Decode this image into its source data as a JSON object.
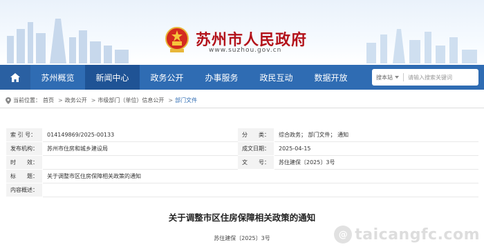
{
  "header": {
    "site_title": "苏州市人民政府",
    "site_url": "www.suzhou.gov.cn"
  },
  "nav": {
    "items": [
      {
        "label": "苏州概览"
      },
      {
        "label": "新闻中心"
      },
      {
        "label": "政务公开"
      },
      {
        "label": "办事服务"
      },
      {
        "label": "政民互动"
      },
      {
        "label": "数据开放"
      }
    ],
    "active_index": 1,
    "search": {
      "category": "搜本站",
      "placeholder": "请输入搜索关键词"
    }
  },
  "breadcrumb": {
    "prefix": "当前位置：",
    "items": [
      "首页",
      "政务公开",
      "市级部门（单位）信息公开",
      "部门文件"
    ]
  },
  "meta": {
    "index_label": "索 引 号：",
    "index_value": "014149869/2025-00133",
    "category_label": "分　　类：",
    "category_value": "综合政务； 部门文件； 通知",
    "publisher_label": "发布机构：",
    "publisher_value": "苏州市住房和城乡建设局",
    "date_label": "成文日期：",
    "date_value": "2025-04-15",
    "time_label": "时　　效：",
    "time_value": "",
    "docnum_label": "文　　号：",
    "docnum_value": "苏住建保〔2025〕3号",
    "subject_label": "标　　题：",
    "subject_value": "关于调整市区住房保障相关政策的通知",
    "summary_label": "内容概述：",
    "summary_value": ""
  },
  "document": {
    "title": "关于调整市区住房保障相关政策的通知",
    "number": "苏住建保〔2025〕3号"
  },
  "watermark": {
    "text": "taicangfc.com"
  },
  "colors": {
    "nav_bg": "#2f6cb3",
    "nav_active": "#1f5395",
    "title_red": "#b3121a"
  }
}
